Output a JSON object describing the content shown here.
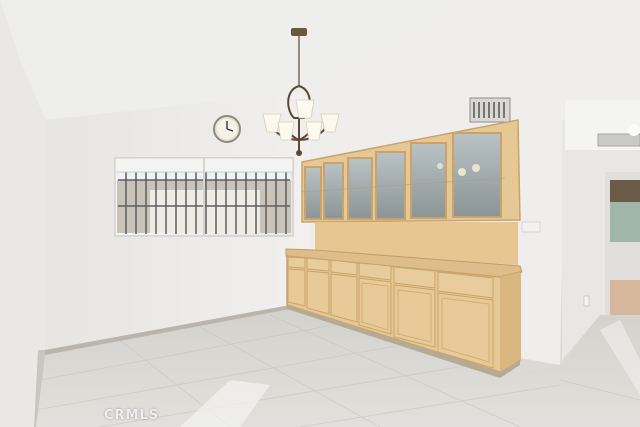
{
  "watermark": {
    "text": "CRMLS"
  },
  "colors": {
    "ceiling": "#eeeeec",
    "wall": "#edecea",
    "wall_shadow": "#e4e3e0",
    "cabinet_wood": "#e6c895",
    "cabinet_edge": "#c9a36b",
    "backsplash": "#e7c692",
    "counter": "#ddbd89",
    "floor": "#d8d6d2",
    "baseboard": "#b9b5ae"
  },
  "icons": {
    "chandelier": "chandelier-icon",
    "clock": "wall-clock-icon",
    "vent": "air-vent-icon"
  }
}
